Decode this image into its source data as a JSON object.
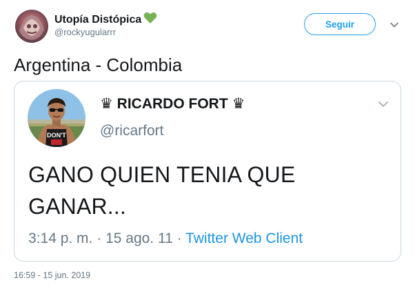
{
  "tweet": {
    "author_name": "Utopía Distópica",
    "author_handle": "@rockyugularrr",
    "follow_label": "Seguir",
    "text": "Argentina - Colombia",
    "timestamp": "16:59 - 15 jun. 2019",
    "heart_color": "#77b255"
  },
  "quoted": {
    "author_name": "♛ RICARDO FORT ♛",
    "author_handle": "@ricarfort",
    "text": "GANO QUIEN TENIA QUE GANAR...",
    "time": "3:14 p. m.",
    "date": "15 ago. 11",
    "separator": "·",
    "source": "Twitter Web Client",
    "avatar_shirt_text": "DON'T"
  },
  "colors": {
    "accent": "#1da1f2",
    "link": "#1b95e0",
    "secondary_text": "#657786",
    "border": "#ccd6dd"
  },
  "icons": {
    "heart": "green-heart-icon",
    "caret": "chevron-down-icon"
  }
}
